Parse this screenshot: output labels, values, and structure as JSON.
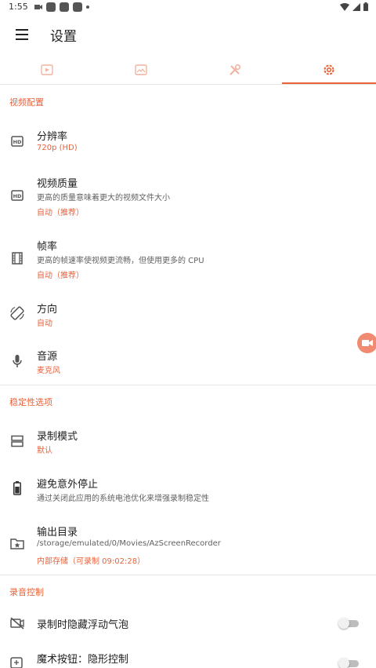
{
  "status_bar": {
    "time": "1:55"
  },
  "app_bar": {
    "title": "设置"
  },
  "tabs": [
    "video-tab-icon",
    "image-tab-icon",
    "tools-tab-icon",
    "settings-tab-icon"
  ],
  "sections": {
    "video": {
      "header": "视频配置",
      "resolution": {
        "title": "分辨率",
        "value": "720p (HD)"
      },
      "quality": {
        "title": "视频质量",
        "subtitle": "更高的质量意味着更大的视频文件大小",
        "value": "自动（推荐）"
      },
      "framerate": {
        "title": "帧率",
        "subtitle": "更高的帧速率使视频更流畅，但使用更多的 CPU",
        "value": "自动（推荐）"
      },
      "orientation": {
        "title": "方向",
        "value": "自动"
      },
      "audio_source": {
        "title": "音源",
        "value": "麦克风"
      }
    },
    "stability": {
      "header": "稳定性选项",
      "record_mode": {
        "title": "录制模式",
        "value": "默认"
      },
      "avoid_stop": {
        "title": "避免意外停止",
        "subtitle": "通过关闭此应用的系统电池优化来增强录制稳定性"
      },
      "output_dir": {
        "title": "输出目录",
        "subtitle": "/storage/emulated/0/Movies/AzScreenRecorder",
        "value": "内部存储（可录制 09:02:28）"
      }
    },
    "recording": {
      "header": "录音控制",
      "hide_bubble": {
        "title": "录制时隐藏浮动气泡",
        "enabled": false
      },
      "magic_button": {
        "title": "魔术按钮：隐形控制",
        "enabled": false
      }
    }
  },
  "colors": {
    "accent": "#e8623a",
    "text": "#212121",
    "secondary": "#616161",
    "divider": "#e6e6e6"
  }
}
